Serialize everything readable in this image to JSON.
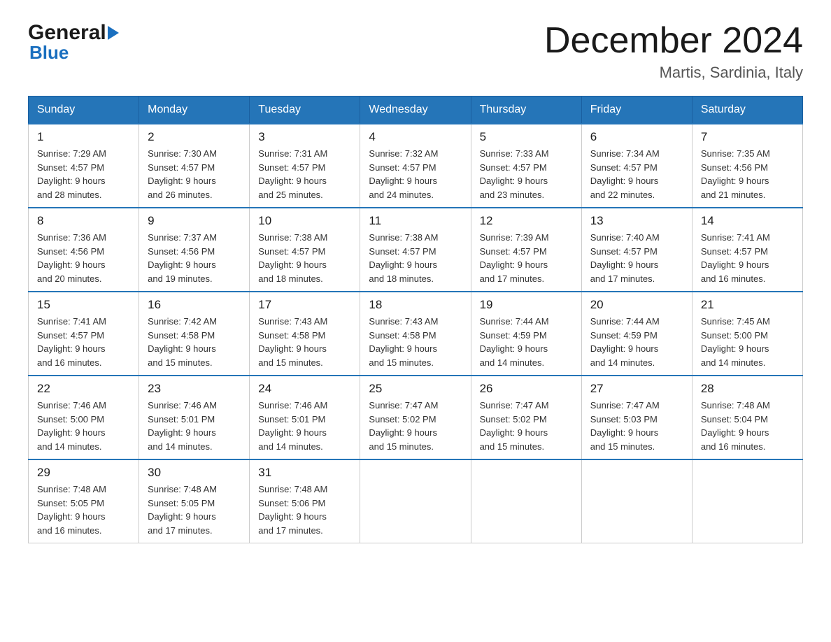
{
  "header": {
    "logo_line1": "General",
    "logo_line2": "Blue",
    "month_title": "December 2024",
    "location": "Martis, Sardinia, Italy"
  },
  "columns": [
    "Sunday",
    "Monday",
    "Tuesday",
    "Wednesday",
    "Thursday",
    "Friday",
    "Saturday"
  ],
  "weeks": [
    [
      {
        "day": "1",
        "sunrise": "7:29 AM",
        "sunset": "4:57 PM",
        "daylight": "9 hours and 28 minutes."
      },
      {
        "day": "2",
        "sunrise": "7:30 AM",
        "sunset": "4:57 PM",
        "daylight": "9 hours and 26 minutes."
      },
      {
        "day": "3",
        "sunrise": "7:31 AM",
        "sunset": "4:57 PM",
        "daylight": "9 hours and 25 minutes."
      },
      {
        "day": "4",
        "sunrise": "7:32 AM",
        "sunset": "4:57 PM",
        "daylight": "9 hours and 24 minutes."
      },
      {
        "day": "5",
        "sunrise": "7:33 AM",
        "sunset": "4:57 PM",
        "daylight": "9 hours and 23 minutes."
      },
      {
        "day": "6",
        "sunrise": "7:34 AM",
        "sunset": "4:57 PM",
        "daylight": "9 hours and 22 minutes."
      },
      {
        "day": "7",
        "sunrise": "7:35 AM",
        "sunset": "4:56 PM",
        "daylight": "9 hours and 21 minutes."
      }
    ],
    [
      {
        "day": "8",
        "sunrise": "7:36 AM",
        "sunset": "4:56 PM",
        "daylight": "9 hours and 20 minutes."
      },
      {
        "day": "9",
        "sunrise": "7:37 AM",
        "sunset": "4:56 PM",
        "daylight": "9 hours and 19 minutes."
      },
      {
        "day": "10",
        "sunrise": "7:38 AM",
        "sunset": "4:57 PM",
        "daylight": "9 hours and 18 minutes."
      },
      {
        "day": "11",
        "sunrise": "7:38 AM",
        "sunset": "4:57 PM",
        "daylight": "9 hours and 18 minutes."
      },
      {
        "day": "12",
        "sunrise": "7:39 AM",
        "sunset": "4:57 PM",
        "daylight": "9 hours and 17 minutes."
      },
      {
        "day": "13",
        "sunrise": "7:40 AM",
        "sunset": "4:57 PM",
        "daylight": "9 hours and 17 minutes."
      },
      {
        "day": "14",
        "sunrise": "7:41 AM",
        "sunset": "4:57 PM",
        "daylight": "9 hours and 16 minutes."
      }
    ],
    [
      {
        "day": "15",
        "sunrise": "7:41 AM",
        "sunset": "4:57 PM",
        "daylight": "9 hours and 16 minutes."
      },
      {
        "day": "16",
        "sunrise": "7:42 AM",
        "sunset": "4:58 PM",
        "daylight": "9 hours and 15 minutes."
      },
      {
        "day": "17",
        "sunrise": "7:43 AM",
        "sunset": "4:58 PM",
        "daylight": "9 hours and 15 minutes."
      },
      {
        "day": "18",
        "sunrise": "7:43 AM",
        "sunset": "4:58 PM",
        "daylight": "9 hours and 15 minutes."
      },
      {
        "day": "19",
        "sunrise": "7:44 AM",
        "sunset": "4:59 PM",
        "daylight": "9 hours and 14 minutes."
      },
      {
        "day": "20",
        "sunrise": "7:44 AM",
        "sunset": "4:59 PM",
        "daylight": "9 hours and 14 minutes."
      },
      {
        "day": "21",
        "sunrise": "7:45 AM",
        "sunset": "5:00 PM",
        "daylight": "9 hours and 14 minutes."
      }
    ],
    [
      {
        "day": "22",
        "sunrise": "7:46 AM",
        "sunset": "5:00 PM",
        "daylight": "9 hours and 14 minutes."
      },
      {
        "day": "23",
        "sunrise": "7:46 AM",
        "sunset": "5:01 PM",
        "daylight": "9 hours and 14 minutes."
      },
      {
        "day": "24",
        "sunrise": "7:46 AM",
        "sunset": "5:01 PM",
        "daylight": "9 hours and 14 minutes."
      },
      {
        "day": "25",
        "sunrise": "7:47 AM",
        "sunset": "5:02 PM",
        "daylight": "9 hours and 15 minutes."
      },
      {
        "day": "26",
        "sunrise": "7:47 AM",
        "sunset": "5:02 PM",
        "daylight": "9 hours and 15 minutes."
      },
      {
        "day": "27",
        "sunrise": "7:47 AM",
        "sunset": "5:03 PM",
        "daylight": "9 hours and 15 minutes."
      },
      {
        "day": "28",
        "sunrise": "7:48 AM",
        "sunset": "5:04 PM",
        "daylight": "9 hours and 16 minutes."
      }
    ],
    [
      {
        "day": "29",
        "sunrise": "7:48 AM",
        "sunset": "5:05 PM",
        "daylight": "9 hours and 16 minutes."
      },
      {
        "day": "30",
        "sunrise": "7:48 AM",
        "sunset": "5:05 PM",
        "daylight": "9 hours and 17 minutes."
      },
      {
        "day": "31",
        "sunrise": "7:48 AM",
        "sunset": "5:06 PM",
        "daylight": "9 hours and 17 minutes."
      },
      null,
      null,
      null,
      null
    ]
  ],
  "labels": {
    "sunrise": "Sunrise:",
    "sunset": "Sunset:",
    "daylight": "Daylight:"
  }
}
